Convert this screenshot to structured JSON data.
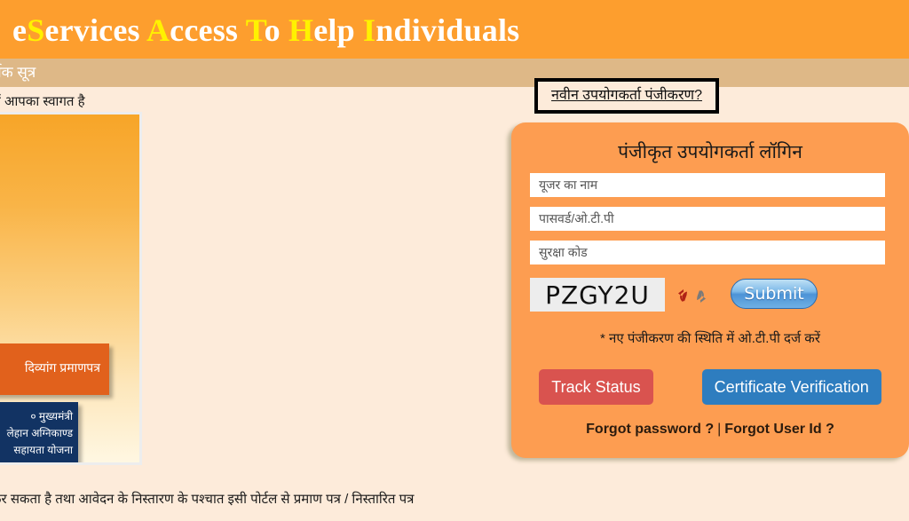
{
  "header": {
    "title_parts": [
      {
        "text": "e",
        "highlight": false
      },
      {
        "text": "S",
        "highlight": true
      },
      {
        "text": "ervices ",
        "highlight": false
      },
      {
        "text": "A",
        "highlight": true
      },
      {
        "text": "ccess ",
        "highlight": false
      },
      {
        "text": "T",
        "highlight": true
      },
      {
        "text": "o ",
        "highlight": false
      },
      {
        "text": "H",
        "highlight": true
      },
      {
        "text": "elp ",
        "highlight": false
      },
      {
        "text": "I",
        "highlight": true
      },
      {
        "text": "ndividuals",
        "highlight": false
      }
    ],
    "title_plain": "eServices Access To Help Individuals",
    "background_color": "#FD9E2E",
    "highlight_color": "#FFF200"
  },
  "nav": {
    "visible_text": "र्पक सूत्र",
    "background_color": "#DEB887"
  },
  "welcome": {
    "text": "ों आपका स्वागत है"
  },
  "promo": {
    "caption_orange": "दिव्यांग प्रमाणपत्र",
    "caption_navy": "० मुख्यमंत्री\nलेहान अग्निकाण्ड\nसहायता योजना",
    "caption_navy_line1": "० मुख्यमंत्री",
    "caption_navy_line2": "लेहान अग्निकाण्ड",
    "caption_navy_line3": "सहायता योजना"
  },
  "register": {
    "link_label": "नवीन उपयोगकर्ता पंजीकरण?"
  },
  "login": {
    "panel_title": "पंजीकृत उपयोगकर्ता लॉगिन",
    "panel_color": "#FD9D51",
    "username_placeholder": "यूजर का नाम",
    "username_value": "",
    "password_placeholder": "पासवर्ड/ओ.टी.पी",
    "password_value": "",
    "captcha_placeholder": "सुरक्षा कोड",
    "captcha_value": "",
    "captcha_text": "PZGY2U",
    "refresh_icon": "refresh-icon",
    "submit_label": "Submit",
    "otp_note": "* नए पंजीकरण की स्थिति में ओ.टी.पी दर्ज करें",
    "track_status_label": "Track Status",
    "track_status_color": "#D9534F",
    "certificate_verification_label": "Certificate Verification",
    "certificate_verification_color": "#2E7DBF",
    "forgot_password_label": "Forgot password ?",
    "forgot_separator": "|",
    "forgot_userid_label": "Forgot User Id ?"
  },
  "footer": {
    "paragraph": "कर सकता है तथा आवेदन के निस्तारण के पश्चात इसी पोर्टल से प्रमाण पत्र / निस्तारित पत्र"
  },
  "page": {
    "background_color": "#FDEBDA"
  }
}
